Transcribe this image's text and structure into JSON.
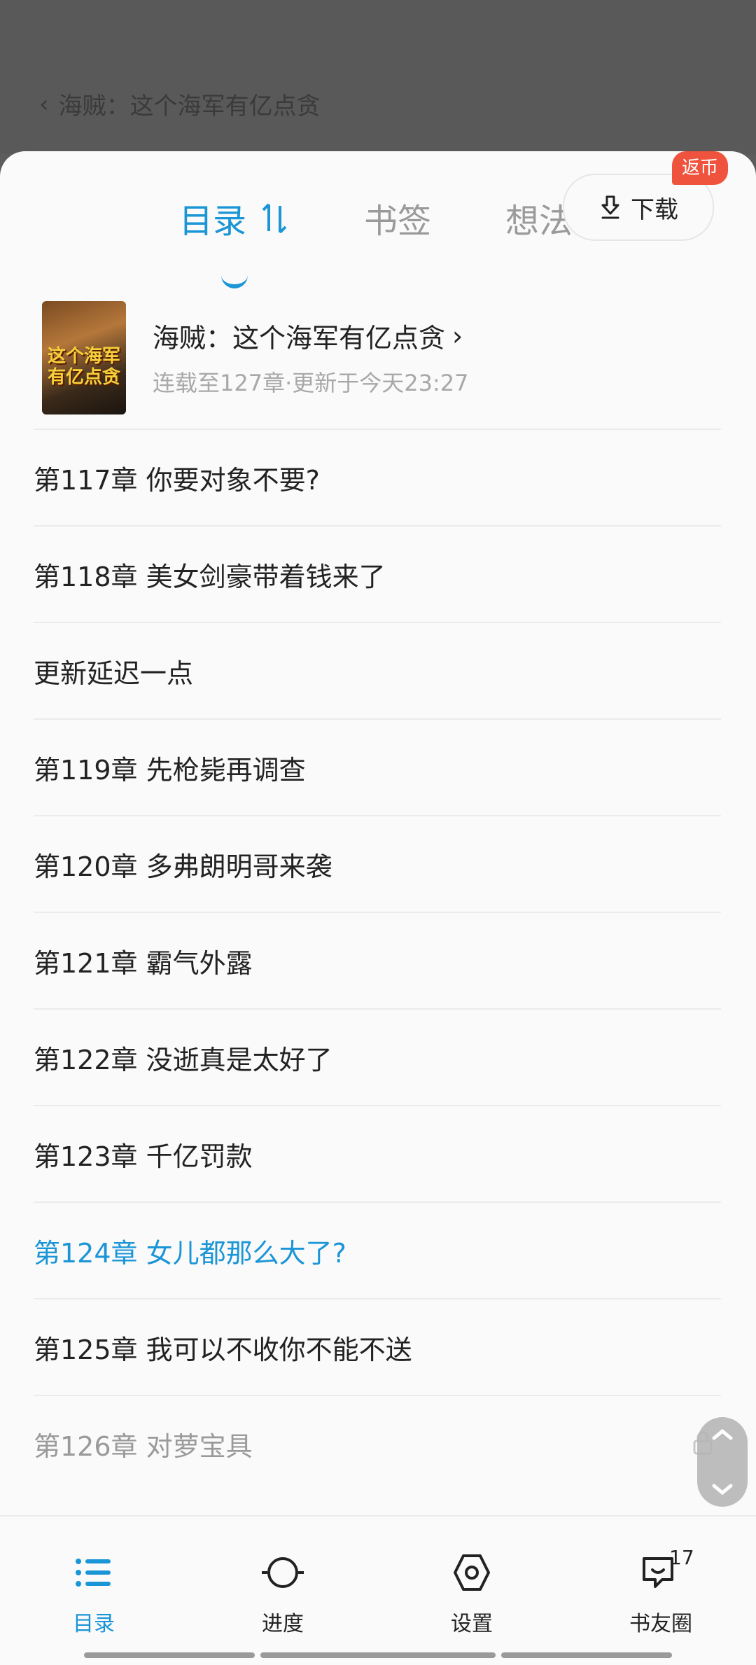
{
  "backdrop": {
    "title": "海贼：这个海军有亿点贪"
  },
  "tabs": [
    {
      "label": "目录",
      "active": true
    },
    {
      "label": "书签",
      "active": false
    },
    {
      "label": "想法",
      "active": false
    }
  ],
  "book": {
    "title": "海贼：这个海军有亿点贪",
    "meta": "连载至127章·更新于今天23:27",
    "cover_text": "这个海军有亿点贪",
    "download_label": "下载",
    "badge": "返币"
  },
  "chapters": [
    {
      "title": "第117章 你要对象不要?",
      "state": "normal"
    },
    {
      "title": "第118章 美女剑豪带着钱来了",
      "state": "normal"
    },
    {
      "title": "更新延迟一点",
      "state": "normal"
    },
    {
      "title": "第119章 先枪毙再调查",
      "state": "normal"
    },
    {
      "title": "第120章 多弗朗明哥来袭",
      "state": "normal"
    },
    {
      "title": "第121章 霸气外露",
      "state": "normal"
    },
    {
      "title": "第122章 没逝真是太好了",
      "state": "normal"
    },
    {
      "title": "第123章 千亿罚款",
      "state": "normal"
    },
    {
      "title": "第124章 女儿都那么大了?",
      "state": "current"
    },
    {
      "title": "第125章 我可以不收你不能不送",
      "state": "normal"
    },
    {
      "title": "第126章 对萝宝具",
      "state": "locked"
    }
  ],
  "nav": [
    {
      "label": "目录",
      "icon": "list-icon",
      "active": true
    },
    {
      "label": "进度",
      "icon": "progress-icon",
      "active": false
    },
    {
      "label": "设置",
      "icon": "settings-icon",
      "active": false
    },
    {
      "label": "书友圈",
      "icon": "chat-icon",
      "active": false,
      "count": "17"
    }
  ],
  "colors": {
    "accent": "#1a95d6",
    "badge": "#f0533d"
  }
}
